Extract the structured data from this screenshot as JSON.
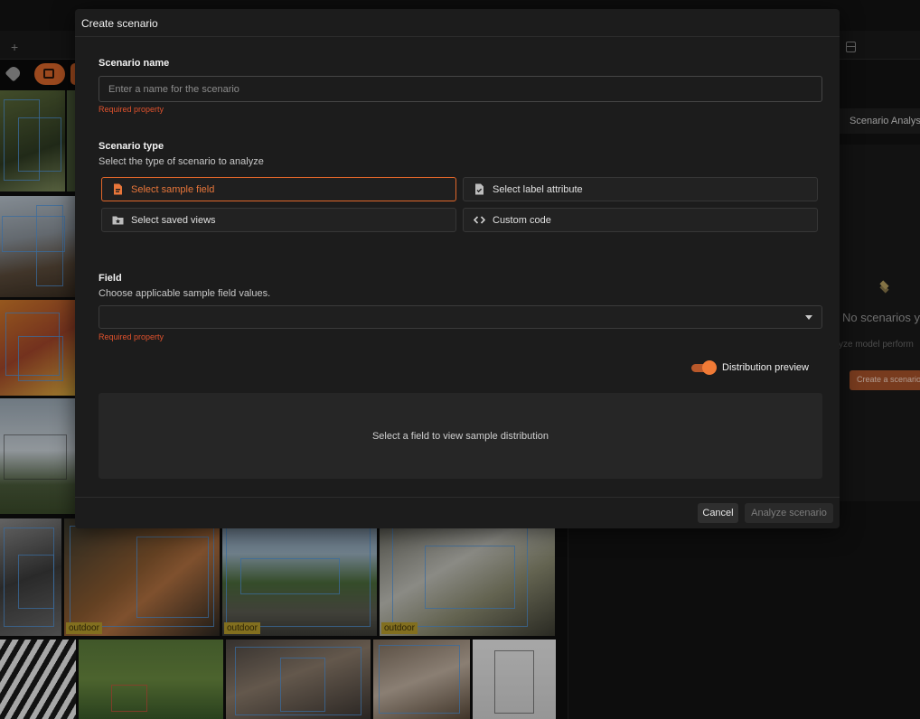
{
  "modal": {
    "title": "Create scenario",
    "scenario_name": {
      "label": "Scenario name",
      "placeholder": "Enter a name for the scenario",
      "value": "",
      "error": "Required property"
    },
    "scenario_type": {
      "label": "Scenario type",
      "description": "Select the type of scenario to analyze",
      "options": [
        {
          "label": "Select sample field",
          "icon": "document-field-icon",
          "selected": true
        },
        {
          "label": "Select label attribute",
          "icon": "document-check-icon",
          "selected": false
        },
        {
          "label": "Select saved views",
          "icon": "folder-star-icon",
          "selected": false
        },
        {
          "label": "Custom code",
          "icon": "code-brackets-icon",
          "selected": false
        }
      ]
    },
    "field": {
      "label": "Field",
      "description": "Choose applicable sample field values.",
      "value": "",
      "error": "Required property"
    },
    "distribution_preview": {
      "label": "Distribution preview",
      "enabled": true,
      "empty_message": "Select a field to view sample distribution"
    },
    "buttons": {
      "cancel": "Cancel",
      "analyze": "Analyze scenario"
    }
  },
  "background": {
    "tab_add": "+",
    "grid_tag_label": "outdoor",
    "right_panel": {
      "header": "Scenario Analysis",
      "empty_title": "No scenarios y",
      "empty_subtitle": "yze model perform",
      "create_button": "Create a scenario"
    }
  },
  "colors": {
    "accent": "#e0662a",
    "error": "#e0522d",
    "modal_bg": "#1c1c1c"
  }
}
